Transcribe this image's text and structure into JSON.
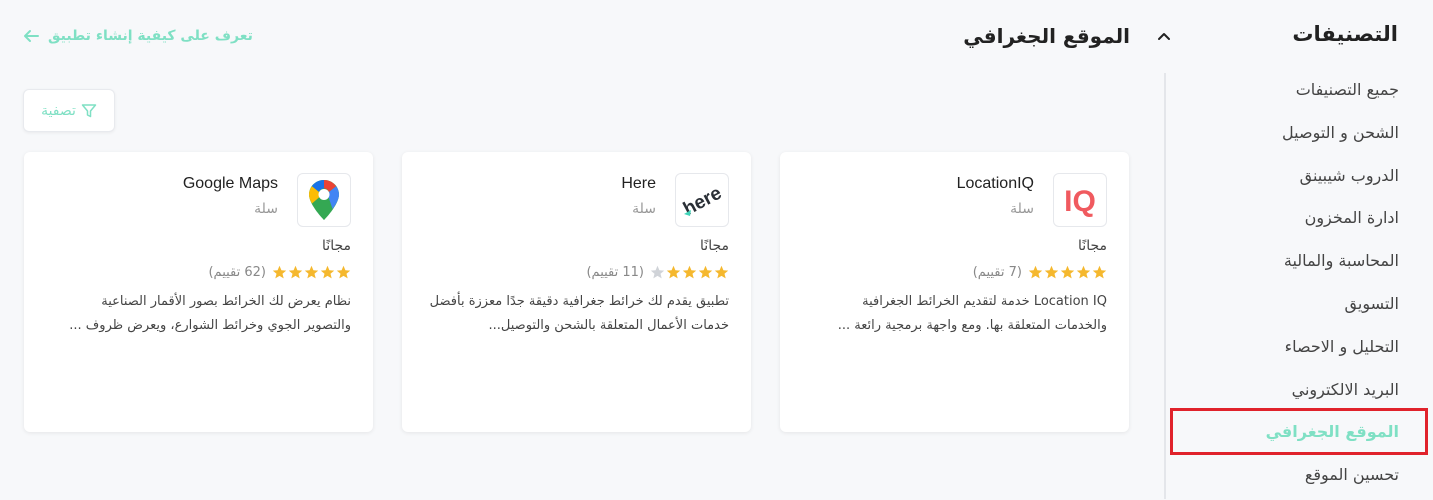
{
  "sidebar": {
    "title": "التصنيفات",
    "items": [
      {
        "label": "جميع التصنيفات"
      },
      {
        "label": "الشحن و التوصيل"
      },
      {
        "label": "الدروب شيبينق"
      },
      {
        "label": "ادارة المخزون"
      },
      {
        "label": "المحاسبة والمالية"
      },
      {
        "label": "التسويق"
      },
      {
        "label": "التحليل و الاحصاء"
      },
      {
        "label": "البريد الالكتروني"
      },
      {
        "label": "الموقع الجغرافي"
      },
      {
        "label": "تحسين الموقع"
      }
    ],
    "active_index": 8
  },
  "header": {
    "title": "الموقع الجغرافي",
    "learn_link": "تعرف على كيفية إنشاء تطبيق"
  },
  "filter": {
    "label": "تصفية"
  },
  "apps": [
    {
      "name": "LocationIQ",
      "vendor": "سلة",
      "price": "مجانًا",
      "rating": 5,
      "rating_count": "(7 تقييم)",
      "description": "Location IQ خدمة لتقديم الخرائط الجغرافية والخدمات المتعلقة بها. ومع واجهة برمجية رائعة ...",
      "logo_icon": "locationiq-logo-icon",
      "logo_text": "IQ"
    },
    {
      "name": "Here",
      "vendor": "سلة",
      "price": "مجانًا",
      "rating": 4,
      "rating_count": "(11 تقييم)",
      "description": "تطبيق يقدم لك خرائط جغرافية دقيقة جدًا معززة بأفضل خدمات الأعمال المتعلقة بالشحن والتوصيل...",
      "logo_icon": "here-logo-icon",
      "logo_text": "here"
    },
    {
      "name": "Google Maps",
      "vendor": "سلة",
      "price": "مجانًا",
      "rating": 5,
      "rating_count": "(62 تقييم)",
      "description": "نظام يعرض لك الخرائط بصور الأقمار الصناعية والتصوير الجوي وخرائط الشوارع، ويعرض ظروف ...",
      "logo_icon": "google-maps-logo-icon"
    }
  ],
  "colors": {
    "accent": "#7fe0c4",
    "star": "#f5b82e",
    "star_empty": "#d0d3d8",
    "active_outline": "#e0222b"
  }
}
